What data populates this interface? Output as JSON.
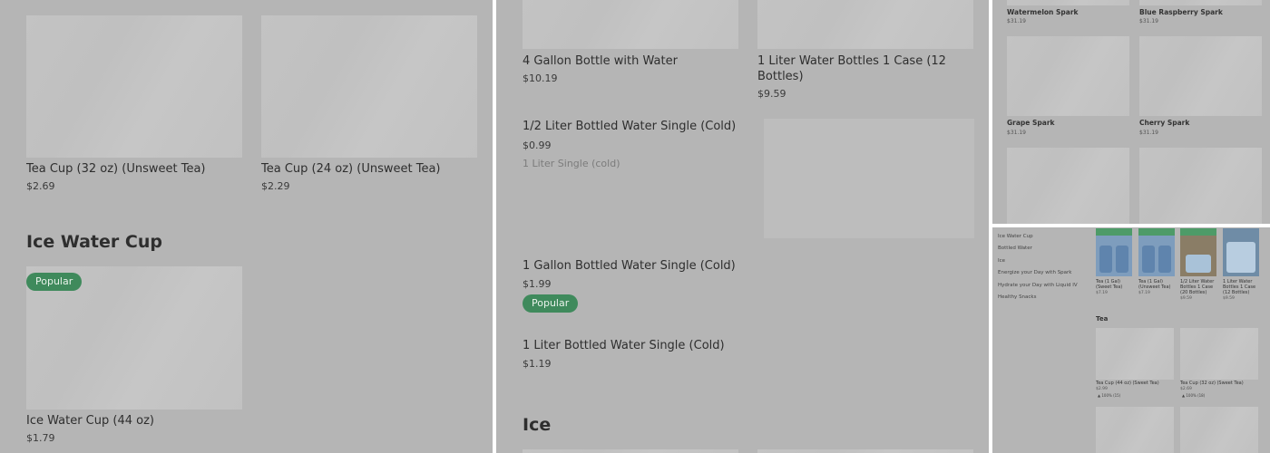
{
  "panel1": {
    "items": [
      {
        "name": "Tea Cup (32 oz) (Unsweet Tea)",
        "price": "$2.69"
      },
      {
        "name": "Tea Cup (24 oz) (Unsweet Tea)",
        "price": "$2.29"
      }
    ],
    "section_title": "Ice Water Cup",
    "badge": "Popular",
    "ice_item": {
      "name": "Ice Water Cup (44 oz)",
      "price": "$1.79"
    }
  },
  "panel2": {
    "items": [
      {
        "name": "4 Gallon Bottle with Water",
        "price": "$10.19"
      },
      {
        "name": "1 Liter Water Bottles 1 Case (12 Bottles)",
        "price": "$9.59"
      },
      {
        "name": "1/2 Liter Bottled Water Single (Cold)",
        "price": "$0.99",
        "desc": "1 Liter Single (cold)"
      },
      {
        "name": "1 Gallon Bottled Water Single (Cold)",
        "price": "$1.99"
      },
      {
        "name": "1 Liter Bottled Water Single (Cold)",
        "price": "$1.19"
      }
    ],
    "badge": "Popular",
    "section_title": "Ice"
  },
  "panel3": {
    "items": [
      {
        "name": "Watermelon Spark",
        "price": "$31.19"
      },
      {
        "name": "Blue Raspberry Spark",
        "price": "$31.19"
      },
      {
        "name": "Grape Spark",
        "price": "$31.19"
      },
      {
        "name": "Cherry Spark",
        "price": "$31.19"
      }
    ]
  },
  "panel4": {
    "sidebar": [
      "Ice Water Cup",
      "Bottled Water",
      "Ice",
      "Energize your Day with Spark",
      "Hydrate your Day with Liquid IV",
      "Healthy Snacks"
    ],
    "thumbs": [
      {
        "name": "Tea (1 Gal) (Sweet Tea)",
        "price": "$7.19"
      },
      {
        "name": "Tea (1 Gal) (Unsweet Tea)",
        "price": "$7.19"
      },
      {
        "name": "1/2 Liter Water Bottles 1 Case (20 Bottles)",
        "price": "$9.59"
      },
      {
        "name": "1 Liter Water Bottles 1 Case (12 Bottles)",
        "price": "$9.59"
      }
    ],
    "section_title": "Tea",
    "tea_items": [
      {
        "name": "Tea Cup (44 oz) (Sweet Tea)",
        "price": "$2.99",
        "rating": "100% (15)"
      },
      {
        "name": "Tea Cup (32 oz) (Sweet Tea)",
        "price": "$2.69",
        "rating": "100% (18)"
      }
    ],
    "rating_icon": "thumbs-up-icon"
  }
}
